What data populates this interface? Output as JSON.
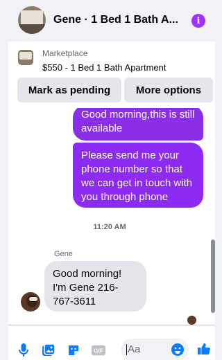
{
  "header": {
    "title": "Gene · 1 Bed 1 Bath A...",
    "info_icon": "info-icon",
    "info_glyph": "i"
  },
  "marketplace": {
    "label": "Marketplace",
    "listing": "$550 - 1 Bed 1 Bath Apartment",
    "mark_pending": "Mark as pending",
    "more_options": "More options"
  },
  "messages": {
    "outgoing": [
      "Good morning,this is still available",
      "Please send me your phone  number so that we can get in touch with you through phone"
    ],
    "timestamp": "11:20 AM",
    "sender": "Gene",
    "incoming": [
      "Good morning!\nI'm Gene 216-767-3611"
    ]
  },
  "composer": {
    "placeholder": "Aa",
    "icons": [
      "microphone-icon",
      "photo-icon",
      "sticker-icon",
      "gif-icon",
      "emoji-icon",
      "thumbs-up-icon"
    ],
    "gif_label": "GIF"
  },
  "colors": {
    "accent": "#0a7cff",
    "outgoing_bubble": "#8a2ee8",
    "info": "#a033ff"
  }
}
